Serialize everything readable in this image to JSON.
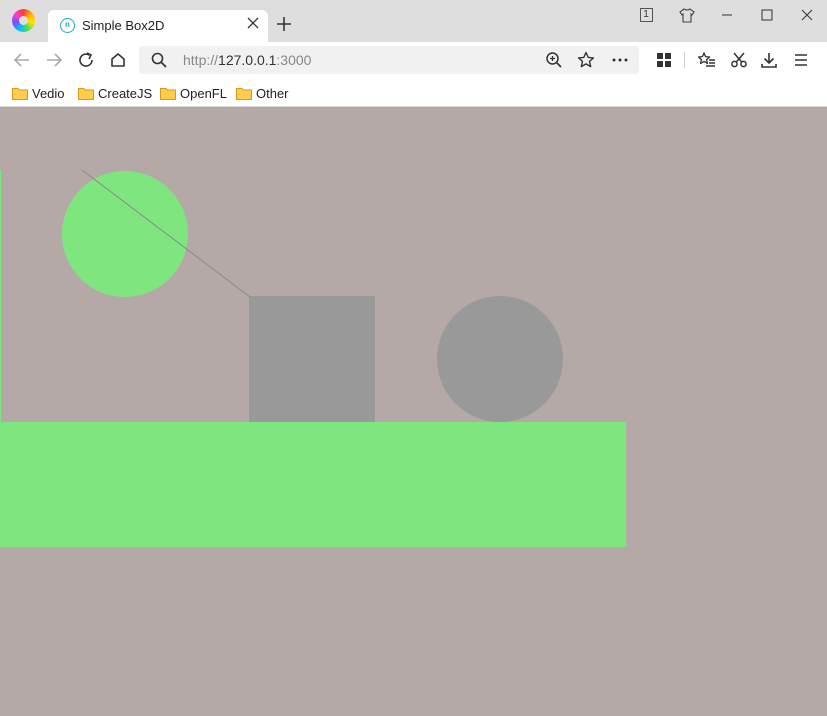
{
  "browser": {
    "tab": {
      "title": "Simple Box2D",
      "favicon_text": "n"
    },
    "tab_count": "1",
    "address": {
      "scheme": "http://",
      "host": "127.0.0.1",
      "port": ":3000"
    }
  },
  "bookmarks": [
    {
      "label": "Vedio"
    },
    {
      "label": "CreateJS"
    },
    {
      "label": "OpenFL"
    },
    {
      "label": "Other"
    }
  ],
  "scene": {
    "colors": {
      "background": "#b5a9a8",
      "active_body": "#7fe57f",
      "sleeping_body": "#999999",
      "joint_line": "#8a8a8a"
    },
    "bodies": [
      {
        "name": "ground",
        "shape": "box",
        "state": "active"
      },
      {
        "name": "green-ball",
        "shape": "circle",
        "state": "active"
      },
      {
        "name": "gray-box",
        "shape": "box",
        "state": "sleeping"
      },
      {
        "name": "gray-ball",
        "shape": "circle",
        "state": "sleeping"
      }
    ],
    "joint": {
      "type": "distance",
      "connects": [
        "green-ball",
        "gray-box"
      ]
    }
  }
}
